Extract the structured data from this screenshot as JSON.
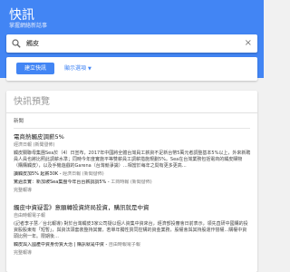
{
  "header": {
    "title": "快訊",
    "subtitle": "掌握網絡新話事"
  },
  "search": {
    "value": "觸皮",
    "clear_icon": "clear-icon"
  },
  "actions": {
    "create_label": "建立快訊",
    "options_label": "顯示選項"
  },
  "preview": {
    "title": "快訊預覽",
    "section_label": "新聞",
    "articles": [
      {
        "title": "電商熱觸皮調薪5%",
        "source": "經濟日報 (新聞發佈)",
        "snippet": "觸皮關聯母集團Sea於（4）日宣布，2017年中國將全體台灣員工薪資不足新台幣5萬元者調整基本5%以上，外來新聘員人員也將比照此調薪水準；同時今年度實施平等雙薪員工調薪措施規劃5%。Sea在台灣業務包括電商的觸皮購物（購購觸皮），以及手機遊戲的Garena（台灣競爭識）…相當於每年之間有更多更高…",
        "extra": [
          {
            "text": "讀觸皮加5% 起薪30K - ",
            "source": "經濟日報 (新聞發佈)"
          },
          {
            "text": "驚過去實：新加坡Sea集團今年台台薪調調5% - ",
            "source": "工商時報 (新聞發佈)"
          }
        ],
        "more": "完整報導"
      },
      {
        "title": "觸皮中資疑雲》意願轉投資終局投資，購訊就是中資",
        "source": "自由時報電子報",
        "snippet": "(記者李子慧／台北報導) 對於台灣觸皮3家公司疑以個人資集中資來台，經濟部投審會日前表示，領先直研中國購的投資股股東有「短暫」，與資法頭套裝整持其實，若單年獨性質同控構的資金業務，股權會與其持股運作營權...購權中資頭比例一年。限期後…",
        "extra": [
          {
            "text": "觸皮與入國產中資身份質大治 | 購訊就是中資 - ",
            "source": "自由時報電子報"
          }
        ],
        "more": "完整報導"
      }
    ]
  }
}
